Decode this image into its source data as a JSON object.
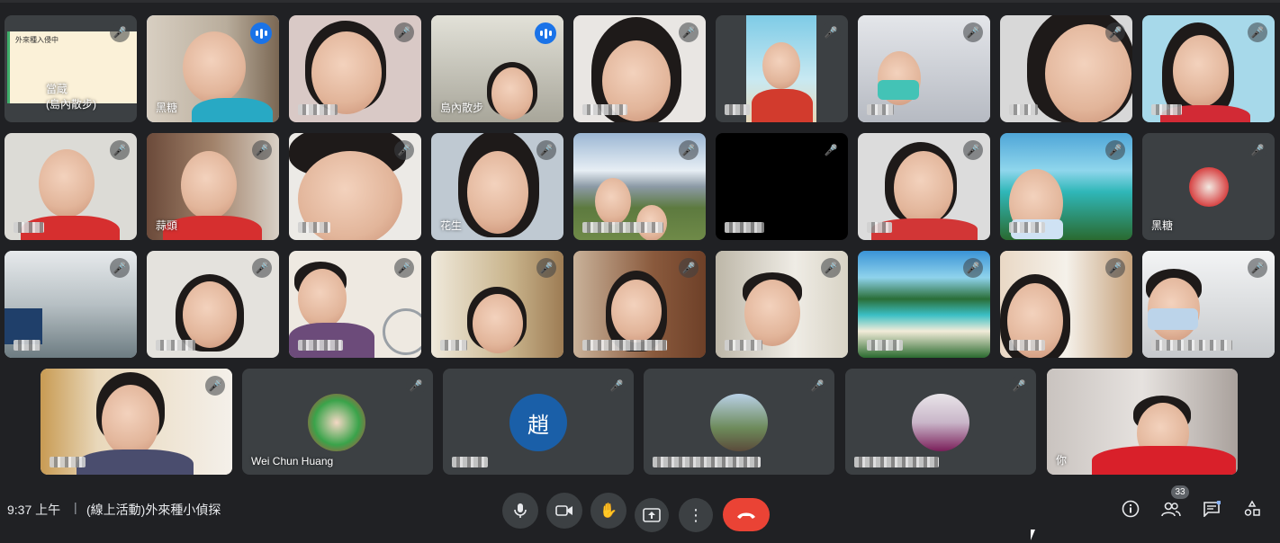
{
  "meeting": {
    "time": "9:37 上午",
    "separator": "|",
    "title": "(線上活動)外來種小偵探"
  },
  "tiles": {
    "t1": {
      "name_line1": "當蔵",
      "name_line2": "(島內散步)",
      "slide_text": "外來種入侵中"
    },
    "t2": {
      "name": "黑糖"
    },
    "t4": {
      "name": "島內散步"
    },
    "t20": {
      "name": "花生"
    },
    "t14": {
      "name": "蒜頭"
    },
    "t27": {
      "name": "黑糖"
    },
    "t37": {
      "name": "Wei Chun Huang"
    },
    "t38": {
      "avatar_letter": "趙"
    },
    "t41": {
      "name": "你"
    }
  },
  "controls": {
    "mic_icon": "microphone-icon",
    "camera_icon": "camera-icon",
    "hand_icon": "raise-hand-icon",
    "present_icon": "present-screen-icon",
    "more_icon": "more-options-icon",
    "hangup_icon": "hangup-icon"
  },
  "right_panel": {
    "participant_count": "33",
    "info_icon": "info-icon",
    "people_icon": "people-icon",
    "chat_icon": "chat-icon",
    "activities_icon": "activities-icon"
  },
  "colors": {
    "background": "#202124",
    "tile": "#3c4043",
    "accent": "#1a73e8",
    "hangup": "#ea4335",
    "avatar": "#1a5fa8"
  }
}
